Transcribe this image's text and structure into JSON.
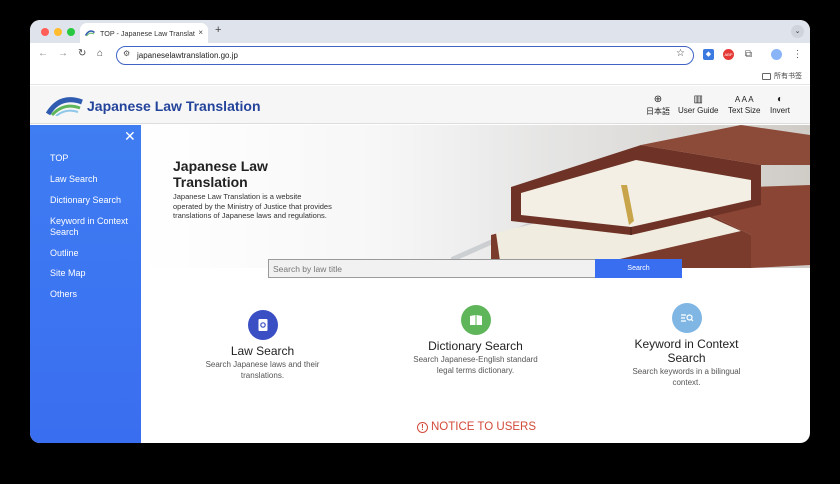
{
  "browser": {
    "tab": {
      "title": "TOP - Japanese Law Translation",
      "close": "×"
    },
    "newtab": "+",
    "tab_menu": "⌄",
    "address": {
      "url": "japaneselawtranslation.go.jp"
    },
    "nav": {
      "back": "←",
      "forward": "→",
      "reload": "↻",
      "home": "⌂"
    },
    "bookmarks": {
      "folder_label": "所有书签"
    }
  },
  "site": {
    "title": "Japanese Law Translation",
    "header_tools": [
      {
        "label": "日本語",
        "icon": "globe-icon",
        "glyph": "⊕"
      },
      {
        "label": "User Guide",
        "icon": "book-icon",
        "glyph": "▥"
      },
      {
        "label": "Text Size",
        "icon": "text-size-icon",
        "glyph": "A A A"
      },
      {
        "label": "Invert",
        "icon": "invert-icon",
        "glyph": "◐"
      }
    ]
  },
  "sidebar": {
    "close": "✕",
    "items": [
      {
        "label": "TOP"
      },
      {
        "label": "Law Search"
      },
      {
        "label": "Dictionary Search"
      },
      {
        "label": "Keyword in Context Search"
      },
      {
        "label": "Outline"
      },
      {
        "label": "Site Map"
      },
      {
        "label": "Others"
      }
    ]
  },
  "hero": {
    "title": "Japanese Law Translation",
    "description": "Japanese Law Translation is a website operated by the Ministry of Justice that provides translations of Japanese laws and regulations."
  },
  "search": {
    "placeholder": "Search by law title",
    "button": "Search"
  },
  "features": [
    {
      "title": "Law Search",
      "description": "Search Japanese laws and their translations.",
      "color": "#3b4fc4",
      "icon": "law-search-icon"
    },
    {
      "title": "Dictionary Search",
      "description": "Search Japanese-English standard legal terms dictionary.",
      "color": "#5fb55a",
      "icon": "dictionary-icon"
    },
    {
      "title": "Keyword in Context Search",
      "description": "Search keywords in a bilingual context.",
      "color": "#7fb6e3",
      "icon": "keyword-search-icon"
    }
  ],
  "notice": {
    "label": "NOTICE TO USERS",
    "icon_glyph": "!"
  },
  "colors": {
    "brand_blue": "#24449b",
    "sidebar": "#3f7df2",
    "search_button": "#3a6ef0",
    "notice": "#d24a3a"
  }
}
